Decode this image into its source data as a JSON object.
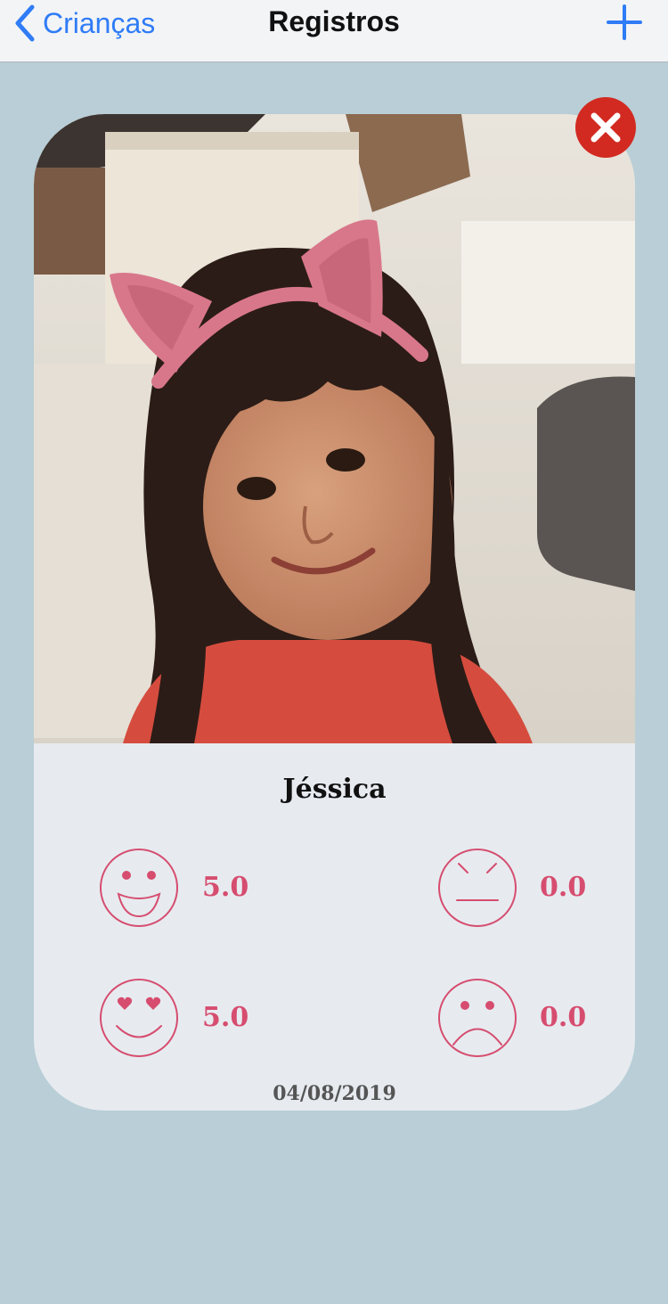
{
  "navbar": {
    "back_label": "Crianças",
    "title": "Registros",
    "add_icon": "plus-icon",
    "accent": "#2f7cf6"
  },
  "card": {
    "child_name": "Jéssica",
    "date": "04/08/2019",
    "score_color": "#d64d6f",
    "ratings": {
      "happy": "5.0",
      "love": "5.0",
      "annoyed": "0.0",
      "sad": "0.0"
    },
    "close_icon": "close-icon"
  }
}
